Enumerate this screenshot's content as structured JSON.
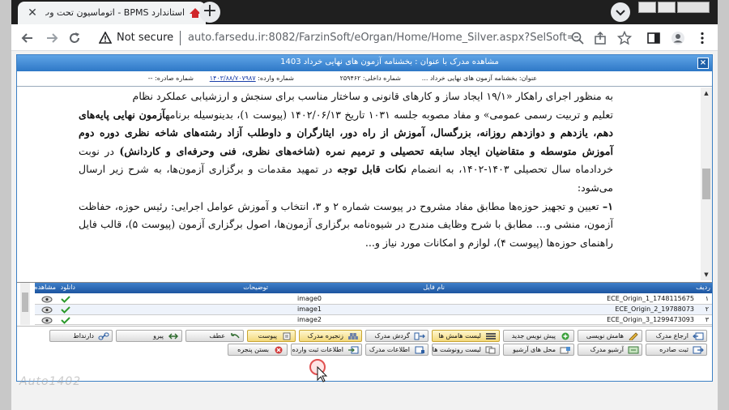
{
  "browser": {
    "tab_title": "استاندارد BPMS - اتوماسیون تحت وب اد",
    "new_tab_symbol": "+",
    "not_secure": "Not secure",
    "url": "auto.farsedu.ir:8082/FarzinSoft/eOrgan/Home/Home_Silver.aspx?SelSoft=746B271..."
  },
  "dialog": {
    "title": "مشاهده مدرک با عنوان : بخشنامه آزمون های نهایی خرداد 1403",
    "close_symbol": "×",
    "meta": {
      "subject": "عنوان: بخشنامه آزمون های نهایی خرداد ...",
      "internal": "شماره داخلی: ۲۵۹۴۶۲",
      "incoming_label": "شماره وارده: ",
      "incoming_value": "۱۴۰۳/۸۸/۷۰۷۹۸۷",
      "issued": "شماره صادره: --"
    },
    "document": {
      "lines": [
        "به منظور اجرای راهکار «۱۹/۱ ایجاد ساز و کارهای قانونی و ساختار مناسب برای سنجش و ارزشیابی عملکرد نظام",
        "تعلیم و تربیت رسمی عمومی» و مفاد مصوبه جلسه ۱۰۳۱ تاریخ ۱۴۰۲/۰۶/۱۳ (پیوست ۱)، بدینوسیله برنامه"
      ],
      "bold_1": "آزمون نهایی پایه‌های دهم، یازدهم و دوازدهم روزانه، بزرگسال، آموزش از راه دور، ایثارگران و داوطلب آزاد رشته‌های شاخه نظری دوره دوم آموزش متوسطه و متقاضیان ایجاد سابقه تحصیلی و ترمیم نمره (شاخه‌های نظری، فنی وحرفه‌ای و کاردانش)",
      "para_mid": " در نوبت خردادماه سال تحصیلی ۱۴۰۳-۱۴۰۲، به انضمام ",
      "bold_2": "نکات قابل توجه",
      "para_end": " در تمهید مقدمات و برگزاری آزمون‌ها، به شرح زیر ارسال می‌شود:",
      "item_num": "۱–",
      "item_text": " تعیین و تجهیز حوزه‌ها مطابق مفاد مشروح در پیوست شماره ۲ و ۳، انتخاب و آموزش عوامل اجرایی: رئیس حوزه، حفاظت آزمون، منشی و... مطابق با شرح وظایف مندرج در شیوه‌نامه برگزاری آزمون‌ها، اصول برگزاری آزمون (پیوست ۵)، قالب فایل راهنمای حوزه‌ها (پیوست ۴)، لوازم و امکانات مورد نیاز و..."
    }
  },
  "grid": {
    "headers": {
      "row": "ردیف",
      "name": "نام فایل",
      "desc": "توضیحات",
      "download": "دانلود",
      "view": "مشاهده"
    },
    "rows": [
      {
        "num": "۱",
        "name": "ECE_Origin_1_1748115675",
        "desc": "image0"
      },
      {
        "num": "۲",
        "name": "ECE_Origin_2_19788073",
        "desc": "image1"
      },
      {
        "num": "۳",
        "name": "ECE_Origin_3_1299473093",
        "desc": "image2"
      }
    ]
  },
  "buttons": {
    "r1": {
      "return": "ارجاع مدرک",
      "margin_note": "هامش نویسی",
      "new_draft": "پیش نویس جدید",
      "margin_list": "لیست هامش ها",
      "doc_flow": "گردش مدرک",
      "doc_chain": "زنجیره مدرک",
      "attachment": "پیوست",
      "delete": "عطف",
      "follow": "پیرو",
      "has_links": "دارنداط"
    },
    "r2": {
      "issue": "ثبت صادره",
      "archive_doc": "آرشیو مدرک",
      "archive_place": "محل های آرشیو",
      "copies_list": "لیست رونوشت ها",
      "doc_info": "اطلاعات مدرک",
      "incoming_info": "اطلاعات ثبت وارده",
      "close_window": "بستن پنجره"
    }
  },
  "watermark": "Auto1402",
  "colors": {
    "title_blue": "#2e78c7",
    "grid_head": "#1d55a0",
    "highlight_btn": "#f3d97c",
    "cursor_ring": "#e05050"
  }
}
